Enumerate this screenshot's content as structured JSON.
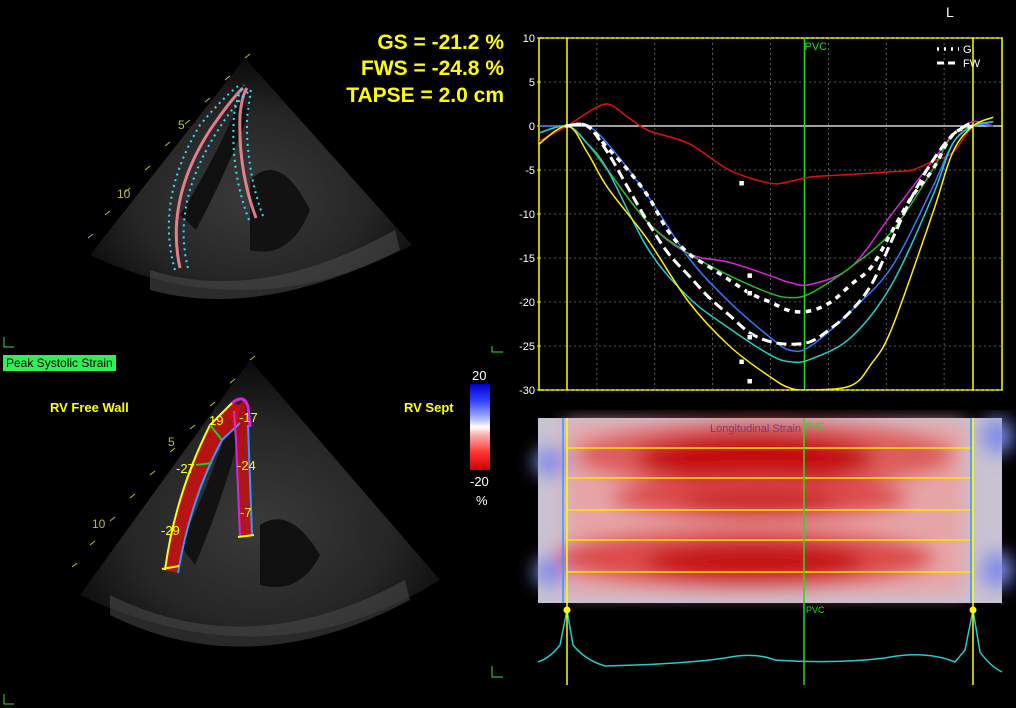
{
  "metrics": {
    "gs": "GS = -21.2 %",
    "fws": "FWS = -24.8 %",
    "tapse": "TAPSE = 2.0 cm"
  },
  "corner_label": "L",
  "bottom_left": {
    "badge": "Peak Systolic Strain",
    "free_wall_label": "RV Free Wall",
    "sept_label": "RV Sept",
    "depth_marks": [
      "5",
      "10"
    ],
    "segment_values": [
      "19",
      "-27",
      "-29",
      "-17",
      "-24",
      "-7"
    ]
  },
  "top_left": {
    "depth_marks": [
      "5",
      "10"
    ]
  },
  "color_scale": {
    "max": "20",
    "min": "-20",
    "unit": "%"
  },
  "colors": {
    "metric_yellow": "#ffff00",
    "series_red": "#e01010",
    "series_magenta": "#dd22dd",
    "series_green": "#22bb22",
    "series_blue": "#3377ff",
    "series_cyan": "#22cccc",
    "series_yellow": "#ffee00",
    "pvc_green": "#22dd22",
    "badge_green": "#33ee55"
  },
  "chart_data": {
    "type": "line",
    "pvc_label": "PVC",
    "ylim": [
      -30,
      10
    ],
    "yticks": [
      "10",
      "5",
      "0",
      "-5",
      "-10",
      "-15",
      "-20",
      "-25",
      "-30"
    ],
    "grid": true,
    "legend_placement": "top-right",
    "legend": [
      "G",
      "FW"
    ],
    "series": [
      {
        "name": "G",
        "style": "dotted-white",
        "x": [
          0,
          0.05,
          0.1,
          0.15,
          0.2,
          0.25,
          0.3,
          0.35,
          0.4,
          0.45,
          0.5,
          0.55,
          0.6,
          0.65,
          0.7,
          0.75,
          0.8,
          0.85,
          0.9,
          0.95,
          1.0
        ],
        "y": [
          0,
          0,
          -2.5,
          -5,
          -8,
          -12,
          -14.5,
          -16,
          -17.5,
          -19,
          -20,
          -21,
          -21,
          -20,
          -18,
          -16,
          -12,
          -8,
          -5,
          -1,
          0
        ]
      },
      {
        "name": "FW",
        "style": "dashed-white",
        "x": [
          0,
          0.05,
          0.1,
          0.15,
          0.2,
          0.25,
          0.3,
          0.35,
          0.4,
          0.45,
          0.5,
          0.55,
          0.6,
          0.65,
          0.7,
          0.75,
          0.8,
          0.85,
          0.9,
          0.95,
          1.0
        ],
        "y": [
          0,
          0,
          -3,
          -7,
          -11,
          -14.5,
          -17,
          -19.5,
          -21.5,
          -23.5,
          -24.5,
          -24.8,
          -24.5,
          -23,
          -21,
          -18,
          -13,
          -8,
          -4,
          -1,
          0.5
        ]
      },
      {
        "x": [
          -0.08,
          0,
          0.05,
          0.1,
          0.15,
          0.2,
          0.3,
          0.4,
          0.5,
          0.55,
          0.6,
          0.7,
          0.8,
          0.85,
          0.9,
          0.95,
          1.0,
          1.05
        ],
        "y": [
          -2,
          0,
          1.5,
          2.5,
          1,
          -0.5,
          -2,
          -5,
          -6.5,
          -6.3,
          -5.8,
          -5.5,
          -5.2,
          -5,
          -4,
          -3,
          0,
          1
        ],
        "color_key": "series_red"
      },
      {
        "x": [
          -0.08,
          0,
          0.05,
          0.1,
          0.2,
          0.3,
          0.4,
          0.5,
          0.55,
          0.6,
          0.7,
          0.8,
          0.9,
          0.95,
          1.0,
          1.05
        ],
        "y": [
          -1,
          0,
          -2,
          -5,
          -11,
          -14.5,
          -15.5,
          -17,
          -17.8,
          -18,
          -16,
          -10,
          -4,
          -1,
          0.5,
          0
        ],
        "color_key": "series_magenta"
      },
      {
        "x": [
          -0.08,
          0,
          0.05,
          0.1,
          0.2,
          0.3,
          0.4,
          0.5,
          0.55,
          0.6,
          0.7,
          0.8,
          0.9,
          0.95,
          1.0,
          1.05
        ],
        "y": [
          -1,
          0,
          -2,
          -5,
          -11,
          -14.5,
          -17,
          -19,
          -19.5,
          -19,
          -16,
          -12,
          -5,
          -1,
          0,
          0.5
        ],
        "color_key": "series_green"
      },
      {
        "x": [
          -0.08,
          0,
          0.05,
          0.1,
          0.2,
          0.3,
          0.4,
          0.5,
          0.55,
          0.6,
          0.7,
          0.8,
          0.9,
          0.95,
          1.0,
          1.05
        ],
        "y": [
          0,
          0,
          0,
          -2,
          -8,
          -15,
          -20,
          -24,
          -25.5,
          -25,
          -21,
          -16,
          -7,
          -2,
          0,
          0
        ],
        "color_key": "series_blue"
      },
      {
        "x": [
          -0.08,
          0,
          0.05,
          0.1,
          0.2,
          0.3,
          0.4,
          0.5,
          0.55,
          0.6,
          0.7,
          0.8,
          0.9,
          0.95,
          1.0,
          1.05
        ],
        "y": [
          -1,
          0,
          -2,
          -5,
          -14,
          -19.5,
          -23,
          -26,
          -26.8,
          -26.5,
          -24,
          -18,
          -8,
          -2,
          0,
          0.5
        ],
        "color_key": "series_cyan"
      },
      {
        "x": [
          -0.08,
          0,
          0.05,
          0.1,
          0.2,
          0.3,
          0.4,
          0.5,
          0.55,
          0.6,
          0.7,
          0.75,
          0.8,
          0.9,
          0.95,
          1.0,
          1.05
        ],
        "y": [
          -2.5,
          0,
          -3,
          -7,
          -13,
          -20,
          -25,
          -28.5,
          -29.8,
          -30,
          -29.5,
          -27,
          -23,
          -10,
          -3,
          0,
          1
        ],
        "color_key": "series_yellow"
      }
    ]
  },
  "heatmap": {
    "pvc_label": "PVC",
    "title": "Longitudinal Strain"
  }
}
